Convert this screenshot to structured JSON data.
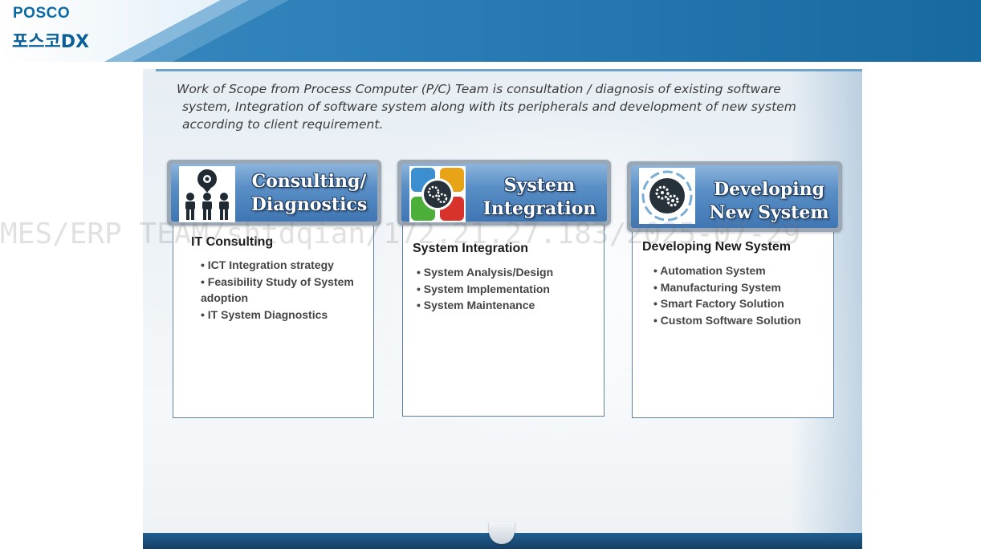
{
  "header": {
    "brand_en": "POSCO",
    "brand_kr": "포스코DX"
  },
  "intro": {
    "line1": "Work of Scope from Process Computer (P/C) Team is consultation / diagnosis of existing software",
    "line2": "system, Integration of software system along with its peripherals and development of new system",
    "line3": "according to client requirement."
  },
  "cards": [
    {
      "title": "Consulting/\nDiagnostics",
      "icon": "consulting-people-icon",
      "heading": "IT Consulting",
      "items": [
        "• ICT Integration strategy",
        "• Feasibility Study of System adoption",
        "• IT System Diagnostics"
      ]
    },
    {
      "title": "System\nIntegration",
      "icon": "integration-gears-icon",
      "heading": "System Integration",
      "items": [
        "• System Analysis/Design",
        "• System Implementation",
        "• System Maintenance"
      ]
    },
    {
      "title": "Developing\nNew System",
      "icon": "development-gears-icon",
      "heading": "Developing New System",
      "items": [
        "• Automation System",
        "• Manufacturing System",
        "• Smart Factory Solution",
        "• Custom Software Solution"
      ]
    }
  ],
  "watermark": "MES/ERP TEAM/shtdqian/172.21.27.183/2025-07-29",
  "colors": {
    "header_blue": "#2a7cb6",
    "card_blue": "#3f76b3",
    "card_border": "#5f7f9c"
  }
}
